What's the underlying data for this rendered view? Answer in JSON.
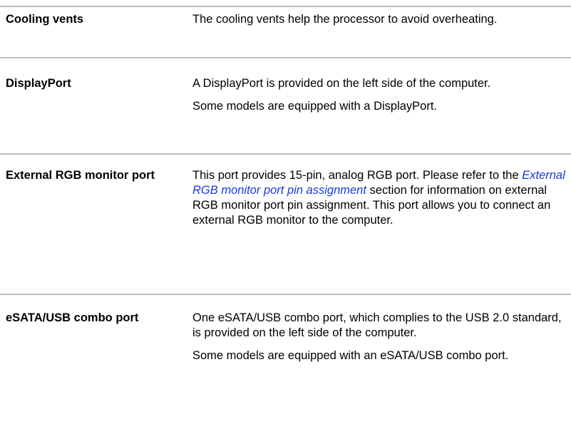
{
  "rows": [
    {
      "term": "Cooling vents",
      "paragraphs": [
        "The cooling vents help the processor to avoid overheating."
      ]
    },
    {
      "term": "DisplayPort",
      "paragraphs": [
        "A DisplayPort is provided on the left side of the computer.",
        "Some models are equipped with a DisplayPort."
      ]
    },
    {
      "term": "External RGB monitor port",
      "paragraph_parts": {
        "before": "This port provides 15-pin, analog RGB port. Please refer to the ",
        "link": "External RGB monitor port pin assignment",
        "after": " section for information on external RGB monitor port pin assignment. This port allows you to connect an external RGB monitor to the computer."
      }
    },
    {
      "term": "eSATA/USB combo port",
      "paragraphs": [
        "One eSATA/USB combo port, which complies to the USB 2.0 standard, is provided on the left side of the computer.",
        "Some models are equipped with an eSATA/USB combo port."
      ]
    }
  ],
  "colors": {
    "rule": "#bdbdbd",
    "link": "#1a3adb",
    "text": "#000000"
  }
}
